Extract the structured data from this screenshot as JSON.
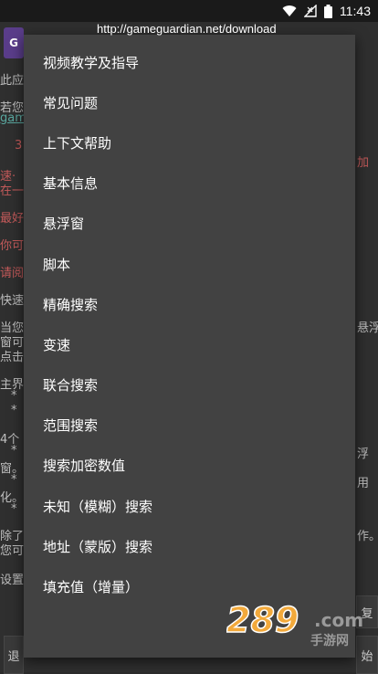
{
  "status": {
    "time": "11:43"
  },
  "header": {
    "logo_letter": "G",
    "url": "http://gameguardian.net/download"
  },
  "background": {
    "left_fragments": [
      "此应",
      "若您",
      "gam",
      "3",
      "速·",
      "在一",
      "最好",
      "你可",
      "请阅",
      "快速",
      "当您",
      "窗可",
      "点击",
      "主界",
      "*",
      "*",
      "4个",
      "*",
      "窗。",
      "*",
      "化。",
      "*",
      "除了",
      "您可",
      "设置"
    ],
    "right_fragments": [
      "加",
      "悬浮",
      "浮",
      "用",
      "作。",
      "复",
      "始"
    ],
    "bottom_left_button": "退"
  },
  "menu": {
    "items": [
      "视频教学及指导",
      "常见问题",
      "上下文帮助",
      "基本信息",
      "悬浮窗",
      "脚本",
      "精确搜索",
      "变速",
      "联合搜索",
      "范围搜索",
      "搜索加密数值",
      "未知（模糊）搜索",
      "地址（蒙版）搜索",
      "填充值（增量）"
    ]
  },
  "watermark": {
    "number": "289",
    "domain": ".com",
    "subtitle": "手游网"
  },
  "colors": {
    "menu_bg": "#424242",
    "menu_text": "#ffffff",
    "accent_red": "#c45a5a",
    "accent_teal": "#5aa8a0"
  }
}
